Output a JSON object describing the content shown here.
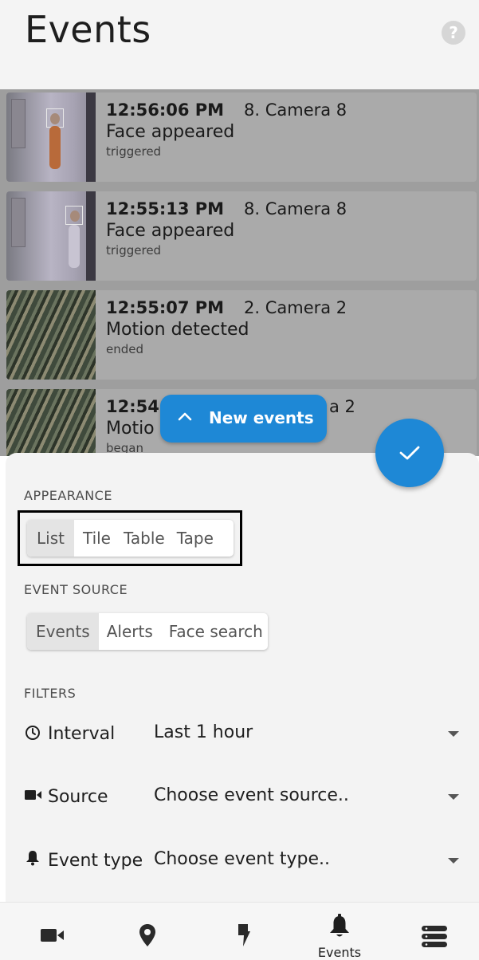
{
  "header": {
    "title": "Events",
    "help_icon": "?"
  },
  "events": [
    {
      "time": "12:56:06 PM",
      "camera": "8. Camera 8",
      "type": "Face appeared",
      "status": "triggered",
      "thumb": "camera-8"
    },
    {
      "time": "12:55:13 PM",
      "camera": "8. Camera 8",
      "type": "Face appeared",
      "status": "triggered",
      "thumb": "camera-8"
    },
    {
      "time": "12:55:07 PM",
      "camera": "2. Camera 2",
      "type": "Motion detected",
      "status": "ended",
      "thumb": "camera-2"
    },
    {
      "time": "12:54:",
      "camera": "a 2",
      "type": "Motio",
      "status": "began",
      "thumb": "camera-2"
    }
  ],
  "new_events_button": {
    "label": "New events",
    "icon": "chevron-up-icon"
  },
  "fab": {
    "icon": "checkmark-icon"
  },
  "appearance": {
    "heading": "APPEARANCE",
    "options": [
      "List",
      "Tile",
      "Table",
      "Tape"
    ],
    "selected": "List"
  },
  "event_source": {
    "heading": "EVENT SOURCE",
    "options": [
      "Events",
      "Alerts",
      "Face search"
    ],
    "selected": "Events"
  },
  "filters": {
    "heading": "FILTERS",
    "interval": {
      "label": "Interval",
      "value": "Last 1 hour",
      "icon": "clock-icon"
    },
    "source": {
      "label": "Source",
      "value": "Choose event source..",
      "icon": "camera-icon"
    },
    "event_type": {
      "label": "Event type",
      "value": "Choose event type..",
      "icon": "bell-icon"
    }
  },
  "navbar": {
    "items": [
      {
        "name": "cameras",
        "icon": "video-camera-icon",
        "label": ""
      },
      {
        "name": "map",
        "icon": "map-pin-icon",
        "label": ""
      },
      {
        "name": "actions",
        "icon": "lightning-icon",
        "label": ""
      },
      {
        "name": "events",
        "icon": "bell-icon",
        "label": "Events"
      },
      {
        "name": "menu",
        "icon": "menu-stack-icon",
        "label": ""
      }
    ]
  },
  "colors": {
    "accent": "#1e88d6",
    "overlay": "#9e9e9e",
    "sheet": "#f3f3f3"
  }
}
